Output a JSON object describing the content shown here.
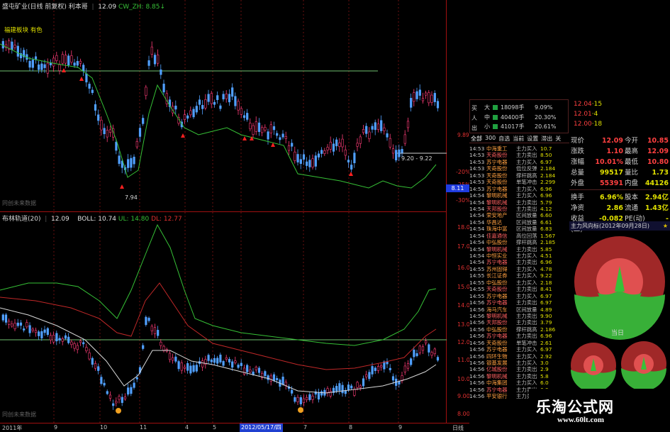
{
  "upper": {
    "stock": "盛屯矿业(日线 前复权)",
    "ind": "利本哥",
    "v1": "12.09",
    "ind2": "CW_ZH:",
    "v2": "8.85↓",
    "legend": "福建板块 有色",
    "lowmark": "7.94",
    "range": "9.20 - 9.22",
    "src": "同创未来数据",
    "price_tag": "8.11"
  },
  "upper_axis": [
    "9.89",
    "-20%",
    "-25%",
    "-30%"
  ],
  "lower": {
    "name": "布林轨道(20)",
    "v0": "12.09",
    "boll_l": "BOLL:",
    "boll_v": "10.74",
    "ul_l": "UL:",
    "ul_v": "14.80",
    "dl_l": "DL:",
    "dl_v": "12.77",
    "src": "同创未来数据"
  },
  "lower_axis": [
    "18.00",
    "17.00",
    "16.00",
    "15.00",
    "14.00",
    "13.00",
    "12.00",
    "11.00",
    "10.00",
    "9.00",
    "8.00"
  ],
  "dates": {
    "year": "2011年",
    "m1": "9",
    "m2": "10",
    "m3": "11",
    "m4": "4",
    "m5": "5",
    "sel": "2012/05/17/四",
    "m6": "7",
    "m7": "8",
    "m8": "9",
    "ctl": "日线"
  },
  "colors": {
    "up": "#ff3c78",
    "down": "#50a0ff",
    "green": "#36c036",
    "mid": "#c02828",
    "yellow": "#e0e000",
    "axis": "#c01818"
  },
  "order": {
    "big": "大",
    "mid": "中",
    "sm": "小",
    "buy": "买",
    "sell": "出",
    "big_v": "18098手",
    "big_p": "9.09%",
    "mid_v": "40400手",
    "mid_p": "20.30%",
    "sm_v": "41017手",
    "sm_p": "20.61%"
  },
  "side_prices": [
    {
      "p": "12.04",
      "v": "15"
    },
    {
      "p": "12.01",
      "v": "4"
    },
    {
      "p": "12.00",
      "v": "18"
    }
  ],
  "tabs": [
    "全部",
    "300",
    "自选",
    "当前",
    "设置",
    "滞出",
    "关"
  ],
  "quote": [
    {
      "l": "现价",
      "v": "12.09",
      "l2": "今开",
      "v2": "10.85"
    },
    {
      "l": "涨跌",
      "v": "1.10",
      "l2": "最高",
      "v2": "12.09"
    },
    {
      "l": "涨幅",
      "v": "10.01%",
      "l2": "最低",
      "v2": "10.80"
    },
    {
      "l": "总量",
      "v": "99517",
      "l2": "量比",
      "v2": "1.73"
    },
    {
      "l": "外盘",
      "v": "55391",
      "l2": "内盘",
      "v2": "44126"
    },
    {
      "l": "换手",
      "v": "6.96%",
      "l2": "股本",
      "v2": "2.94亿"
    },
    {
      "l": "净资",
      "v": "2.86",
      "l2": "流通",
      "v2": "1.43亿"
    },
    {
      "l": "收益(二)",
      "v": "-0.082",
      "l2": "PE(动)",
      "v2": "-"
    }
  ],
  "gauge_title": "主力风向标(2012年09月28日)",
  "gauge_day": "当日",
  "watermark": "乐淘公式网",
  "watermark_url": "www.60lt.com",
  "table": [
    [
      "14:53",
      "中海重工",
      "主力买入",
      "10.7"
    ],
    [
      "14:53",
      "天奇股份",
      "主力卖出",
      "8.50"
    ],
    [
      "14:53",
      "苏宁电器",
      "主力买入",
      "6.97"
    ],
    [
      "14:53",
      "天奇股份",
      "低位反弹",
      "2.184"
    ],
    [
      "14:53",
      "天奇股份",
      "撑杆跳高",
      "2.184"
    ],
    [
      "14:53",
      "天奇股份",
      "单笔冲击",
      "2.299"
    ],
    [
      "14:53",
      "苏宁电器",
      "主力买入",
      "6.96"
    ],
    [
      "14:54",
      "黎明机械",
      "主力买入",
      "6.96"
    ],
    [
      "14:54",
      "黎明机械",
      "主力卖出",
      "5.79"
    ],
    [
      "14:54",
      "天邦股份",
      "主力卖出",
      "4.12"
    ],
    [
      "14:54",
      "荣安地产",
      "区间放量",
      "6.60"
    ],
    [
      "14:54",
      "华昌达",
      "区间放量",
      "6.61"
    ],
    [
      "14:54",
      "珠海中富",
      "区间放量",
      "6.83"
    ],
    [
      "14:54",
      "佳嘉通信",
      "高位回落",
      "1.567"
    ],
    [
      "14:54",
      "中弘股份",
      "撑杆跳高",
      "2.185"
    ],
    [
      "14:54",
      "黎明机械",
      "主力卖出",
      "5.85"
    ],
    [
      "14:54",
      "中恒实业",
      "主力买入",
      "4.51"
    ],
    [
      "14:54",
      "苏宁电器",
      "主力卖出",
      "6.96"
    ],
    [
      "14:55",
      "苏州固锝",
      "主力买入",
      "4.78"
    ],
    [
      "14:55",
      "长江证券",
      "主力买入",
      "9.22"
    ],
    [
      "14:55",
      "中弘股份",
      "主力买入",
      "2.18"
    ],
    [
      "14:55",
      "天奇股份",
      "主力卖出",
      "8.41"
    ],
    [
      "14:55",
      "苏宁电器",
      "主力买入",
      "6.97"
    ],
    [
      "14:56",
      "苏宁电器",
      "主力卖出",
      "6.97"
    ],
    [
      "14:56",
      "海马汽车",
      "区间放量",
      "4.89"
    ],
    [
      "14:56",
      "黎明机械",
      "主力卖出",
      "9.90"
    ],
    [
      "14:56",
      "天邦股份",
      "主力卖出",
      "3.79"
    ],
    [
      "14:56",
      "中弘股份",
      "撑杆跳高",
      "2.186"
    ],
    [
      "14:56",
      "苏宁电器",
      "主力卖出",
      "6.96"
    ],
    [
      "14:56",
      "天奇股份",
      "单笔冲击",
      "2.61"
    ],
    [
      "14:56",
      "苏宁电器",
      "主力买入",
      "6.97"
    ],
    [
      "14:56",
      "四环生物",
      "主力买入",
      "2.92"
    ],
    [
      "14:56",
      "银基发展",
      "主力买入",
      "3.0"
    ],
    [
      "14:56",
      "亿城股份",
      "主力卖出",
      "2.9"
    ],
    [
      "14:56",
      "黎明机械",
      "主力卖出",
      "5.8"
    ],
    [
      "14:56",
      "中海集团",
      "主力买入",
      "6.0"
    ],
    [
      "14:56",
      "苏宁电器",
      "主力卖出",
      "6.9"
    ],
    [
      "14:56",
      "平安银行",
      "主力买入",
      "6.9"
    ]
  ]
}
